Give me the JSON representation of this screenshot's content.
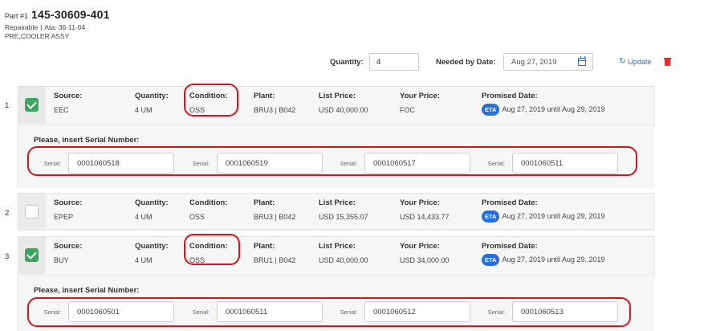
{
  "header": {
    "part_label": "Part #1",
    "part_number": "145-30609-401",
    "repairable": "Repairable",
    "separator": "|",
    "ata": "Ata: 36-11-04",
    "description": "PRE,COOLER ASSY"
  },
  "controls": {
    "quantity_label": "Quantity:",
    "quantity_value": "4",
    "needed_label": "Needed by Date:",
    "needed_value": "Aug 27, 2019",
    "update_label": "Update",
    "refresh_glyph": "↻"
  },
  "columns": {
    "source": "Source:",
    "quantity": "Quantity:",
    "condition": "Condition:",
    "plant": "Plant:",
    "list_price": "List Price:",
    "your_price": "Your Price:",
    "promised_date": "Promised Date:"
  },
  "eta_badge": "ETA",
  "serial_prompt": "Please, insert Serial Number:",
  "serial_label": "Serial:",
  "rows": [
    {
      "number": "1",
      "checked": true,
      "source": "EEC",
      "quantity": "4 UM",
      "condition": "OSS",
      "plant": "BRU3 | B042",
      "list_price": "USD 40,000.00",
      "your_price": "FOC",
      "promised_date": "Aug 27, 2019 until Aug 29, 2019",
      "serials": [
        "0001060518",
        "0001060519",
        "0001060517",
        "0001060511"
      ]
    },
    {
      "number": "2",
      "checked": false,
      "source": "EPEP",
      "quantity": "4 UM",
      "condition": "OSS",
      "plant": "BRU3 | B042",
      "list_price": "USD 15,355.07",
      "your_price": "USD 14,433.77",
      "promised_date": "Aug 27, 2019 until Aug 29, 2019",
      "serials": []
    },
    {
      "number": "3",
      "checked": true,
      "source": "BUY",
      "quantity": "4 UM",
      "condition": "OSS",
      "plant": "BRU1 | B042",
      "list_price": "USD 40,000.00",
      "your_price": "USD 34,000.00",
      "promised_date": "Aug 27, 2019 until Aug 29, 2019",
      "serials": [
        "0001060501",
        "0001060511",
        "0001060512",
        "0001060513"
      ]
    }
  ],
  "colors": {
    "accent_blue": "#2a6ed8",
    "check_green": "#3da65e",
    "delete_red": "#d9322f",
    "annotation_red": "#d7141a"
  },
  "icons": [
    "calendar-icon",
    "refresh-icon",
    "trash-icon",
    "check-icon"
  ]
}
